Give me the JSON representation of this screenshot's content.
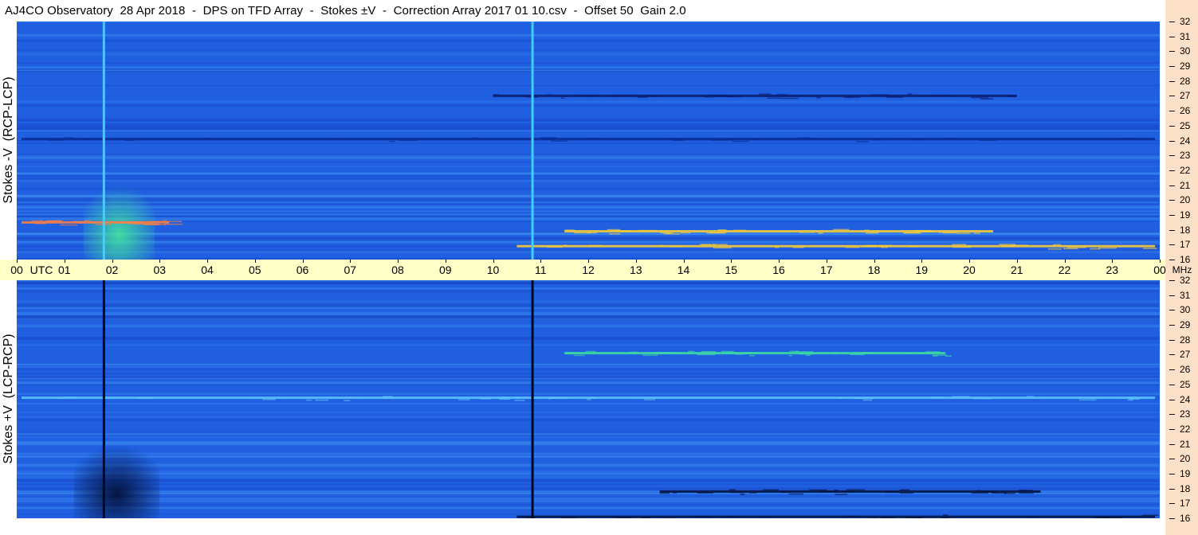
{
  "title": "AJ4CO Observatory  28 Apr 2018  -  DPS on TFD Array  -  Stokes ±V  -  Correction Array 2017 01 10.csv  -  Offset 50  Gain 2.0",
  "chart_data": [
    {
      "type": "heatmap",
      "ylabel": "Stokes -V  (RCP-LCP)",
      "x_ticks": [
        "00",
        "01",
        "02",
        "03",
        "04",
        "05",
        "06",
        "07",
        "08",
        "09",
        "10",
        "11",
        "12",
        "13",
        "14",
        "15",
        "16",
        "17",
        "18",
        "19",
        "20",
        "21",
        "22",
        "23",
        "00"
      ],
      "x_unit": "UTC",
      "xlim": [
        0,
        24
      ],
      "ylim": [
        16,
        32
      ],
      "y_ticks": [
        16,
        17,
        18,
        19,
        20,
        21,
        22,
        23,
        24,
        25,
        26,
        27,
        28,
        29,
        30,
        31,
        32
      ],
      "y_unit": "MHz",
      "colors": {
        "background": "#1f5fe0",
        "bright": "#2fd8ff",
        "hot": "#ffee40",
        "hotter": "#ff6a3a",
        "dark": "#0a1a6a"
      },
      "vertical_lines": [
        {
          "x": 1.83,
          "color": "#3fd0ff"
        },
        {
          "x": 10.83,
          "color": "#3fd0ff"
        }
      ],
      "bursts": [
        {
          "x_start": 1.4,
          "x_end": 2.9,
          "y_start": 16,
          "y_end": 21.5,
          "color": "#40e0a0"
        }
      ],
      "bands": [
        {
          "x_start": 11.5,
          "x_end": 20.5,
          "y": 17.9,
          "color": "#ffd030"
        },
        {
          "x_start": 0.1,
          "x_end": 3.2,
          "y": 18.5,
          "color": "#ff8040"
        },
        {
          "x_start": 0.1,
          "x_end": 23.9,
          "y": 24.1,
          "color": "#0a2a90"
        },
        {
          "x_start": 10.5,
          "x_end": 23.9,
          "y": 16.9,
          "color": "#ffd030"
        },
        {
          "x_start": 10.0,
          "x_end": 21.0,
          "y": 27.0,
          "color": "#0a1a6a"
        }
      ]
    },
    {
      "type": "heatmap",
      "ylabel": "Stokes +V  (LCP-RCP)",
      "x_ticks": [
        "00",
        "01",
        "02",
        "03",
        "04",
        "05",
        "06",
        "07",
        "08",
        "09",
        "10",
        "11",
        "12",
        "13",
        "14",
        "15",
        "16",
        "17",
        "18",
        "19",
        "20",
        "21",
        "22",
        "23",
        "00"
      ],
      "x_unit": "UTC",
      "xlim": [
        0,
        24
      ],
      "ylim": [
        16,
        32
      ],
      "y_ticks": [
        16,
        17,
        18,
        19,
        20,
        21,
        22,
        23,
        24,
        25,
        26,
        27,
        28,
        29,
        30,
        31,
        32
      ],
      "y_unit": "MHz",
      "colors": {
        "background": "#1f5fe0",
        "bright": "#2fd8ff",
        "dark": "#03103a"
      },
      "vertical_lines": [
        {
          "x": 1.83,
          "color": "#000820"
        },
        {
          "x": 10.83,
          "color": "#000820"
        }
      ],
      "bursts": [
        {
          "x_start": 1.2,
          "x_end": 3.0,
          "y_start": 16,
          "y_end": 21.5,
          "color": "#03103a"
        }
      ],
      "bands": [
        {
          "x_start": 13.5,
          "x_end": 21.5,
          "y": 17.8,
          "color": "#03103a"
        },
        {
          "x_start": 0.1,
          "x_end": 23.9,
          "y": 24.1,
          "color": "#60c8ff"
        },
        {
          "x_start": 10.5,
          "x_end": 23.9,
          "y": 16.1,
          "color": "#03103a"
        },
        {
          "x_start": 11.5,
          "x_end": 19.5,
          "y": 27.1,
          "color": "#40e0a0"
        }
      ]
    }
  ]
}
